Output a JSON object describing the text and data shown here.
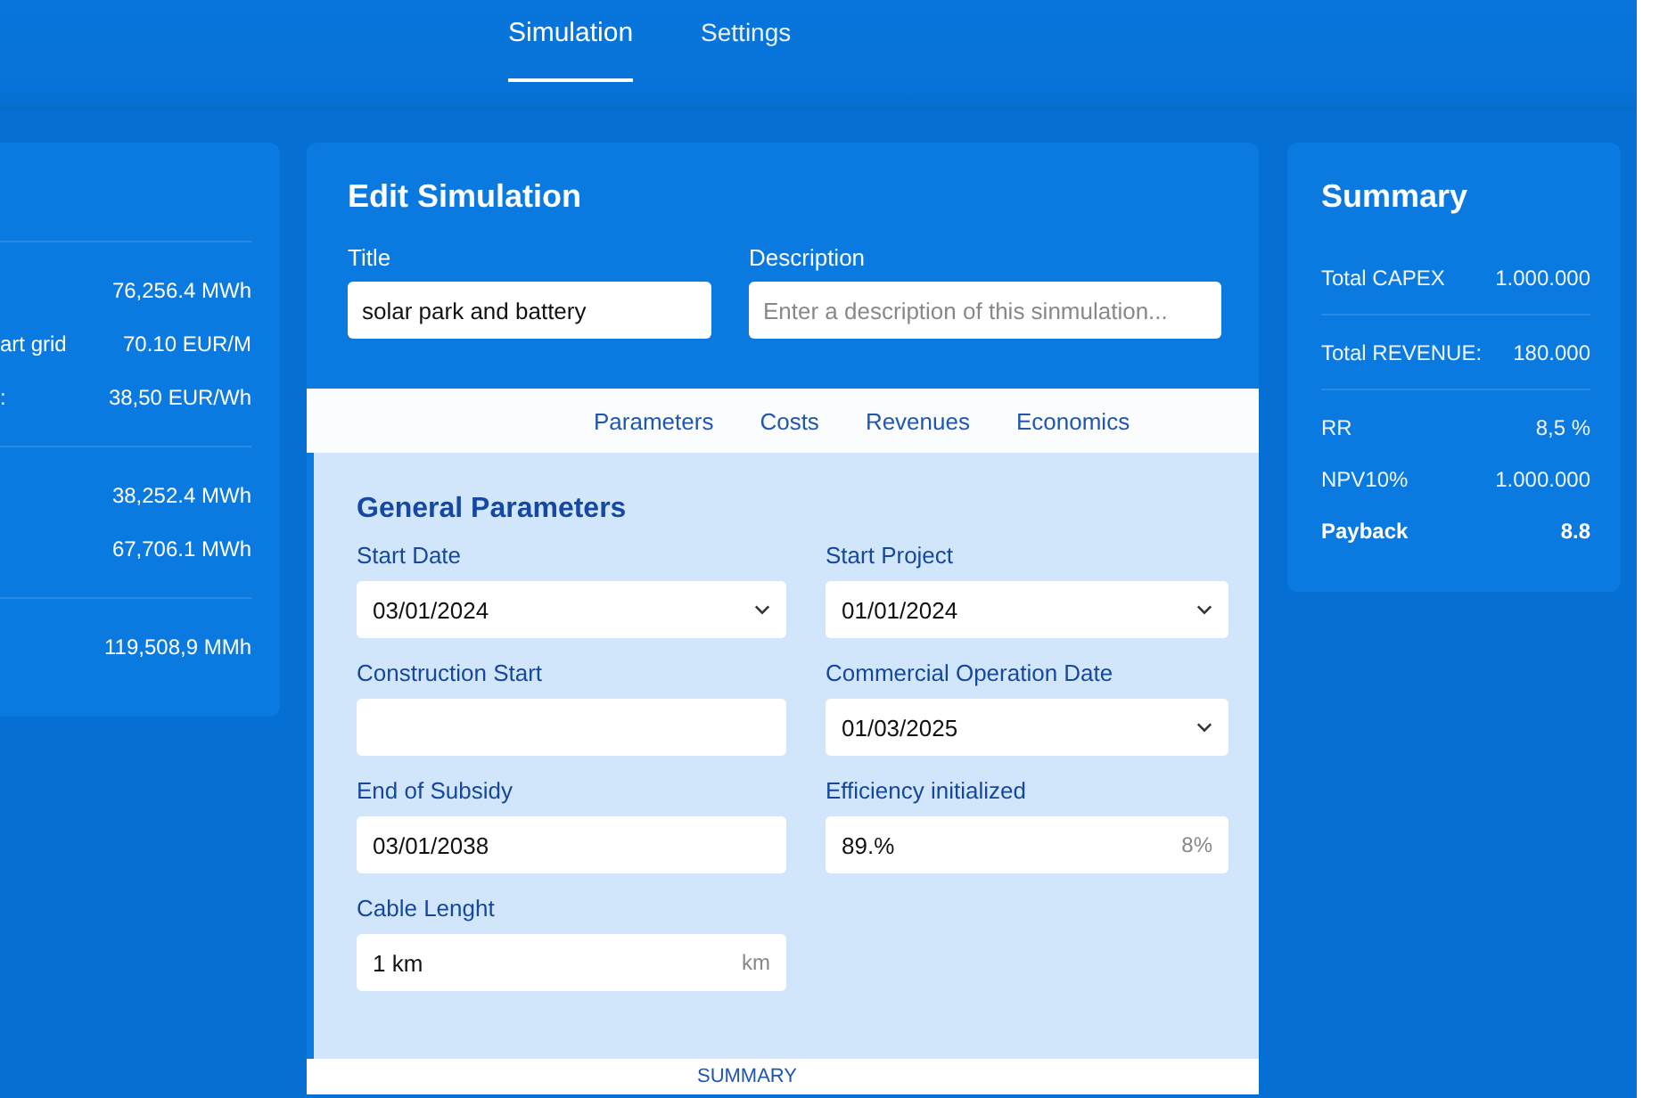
{
  "nav": {
    "tabs": [
      {
        "label": "Simulation",
        "selected": true
      },
      {
        "label": "Settings",
        "selected": false
      }
    ]
  },
  "results_panel": {
    "groups": [
      [
        {
          "value": "76,256.4 MWh"
        },
        {
          "label": "art grid",
          "value": "70.10 EUR/M"
        },
        {
          "label": ":",
          "value": "38,50 EUR/Wh"
        }
      ],
      [
        {
          "value": "38,252.4 MWh"
        },
        {
          "value": "67,706.1 MWh"
        }
      ],
      [
        {
          "value": "119,508,9 MMh"
        }
      ]
    ]
  },
  "editor": {
    "title": "Edit Simulation",
    "fields": [
      {
        "label": "Title",
        "value": "solar park and battery"
      },
      {
        "label": "Description",
        "placeholder": "Enter a description of this sinmulation..."
      }
    ],
    "tabs": [
      {
        "label": "Parameters"
      },
      {
        "label": "Costs"
      },
      {
        "label": "Revenues"
      },
      {
        "label": "Economics"
      }
    ],
    "section_title": "General Parameters",
    "params": [
      {
        "label": "Start Date",
        "kind": "select",
        "value": "03/01/2024"
      },
      {
        "label": "Start Project",
        "kind": "select",
        "value": "01/01/2024"
      },
      {
        "label": "Construction Start",
        "kind": "text"
      },
      {
        "label": "Commercial Operation Date",
        "kind": "select",
        "value": "01/03/2025"
      },
      {
        "label": "End of Subsidy",
        "kind": "text",
        "value": "03/01/2038"
      },
      {
        "label": "Efficiency initialized",
        "kind": "unit",
        "value": "89.%",
        "unit": "8%"
      },
      {
        "label": "Cable Lenght",
        "kind": "unit",
        "value": "1 km",
        "unit": "km"
      }
    ],
    "footer": "SUMMARY"
  },
  "summary": {
    "title": "Summary",
    "groups": [
      [
        {
          "label": "Total CAPEX",
          "value": "1.000.000",
          "strong": false
        }
      ],
      [
        {
          "label": "Total REVENUE:",
          "value": "180.000",
          "strong": false
        }
      ],
      [
        {
          "label": "RR",
          "value": "8,5 %",
          "strong": false
        },
        {
          "label": "NPV10%",
          "value": "1.000.000",
          "strong": false
        },
        {
          "label": "Payback",
          "value": "8.8",
          "strong": true
        }
      ]
    ]
  }
}
